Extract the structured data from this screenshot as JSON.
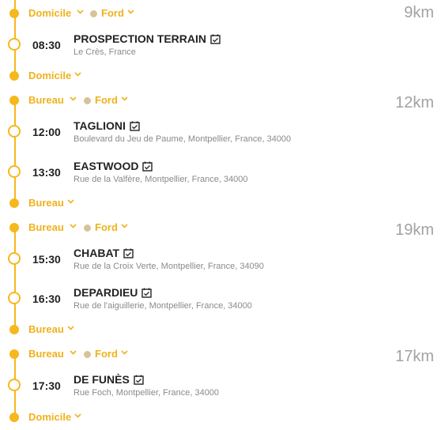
{
  "colors": {
    "accent": "#f6b81c",
    "vehicle_dot": "#d7c39a",
    "distance": "#a2a2a2"
  },
  "segments": [
    {
      "start": "Domicile",
      "vehicle": "Ford",
      "distance": "9km",
      "stops": [
        {
          "time": "08:30",
          "name": "PROSPECTION TERRAIN",
          "address": "Le Crès, France"
        }
      ],
      "end": "Domicile"
    },
    {
      "start": "Bureau",
      "vehicle": "Ford",
      "distance": "12km",
      "stops": [
        {
          "time": "12:00",
          "name": "TAGLIONI",
          "address": "Boulevard du Jeu de Paume, Montpellier, France, 34000"
        },
        {
          "time": "13:30",
          "name": "EASTWOOD",
          "address": "Rue de la Valfère, Montpellier, France, 34000"
        }
      ],
      "end": "Bureau"
    },
    {
      "start": "Bureau",
      "vehicle": "Ford",
      "distance": "19km",
      "stops": [
        {
          "time": "15:30",
          "name": "CHABAT",
          "address": "Rue de la Croix Verte, Montpellier, France, 34090"
        },
        {
          "time": "16:30",
          "name": "DEPARDIEU",
          "address": "Rue de l'aiguillerie, Montpellier, France, 34000"
        }
      ],
      "end": "Bureau"
    },
    {
      "start": "Bureau",
      "vehicle": "Ford",
      "distance": "17km",
      "stops": [
        {
          "time": "17:30",
          "name": "DE FUNÈS",
          "address": "Rue Foch, Montpellier, France, 34000"
        }
      ],
      "end": "Domicile"
    }
  ],
  "icons": {
    "chevron": "chevron-down-icon",
    "calendar": "calendar-check-icon"
  }
}
